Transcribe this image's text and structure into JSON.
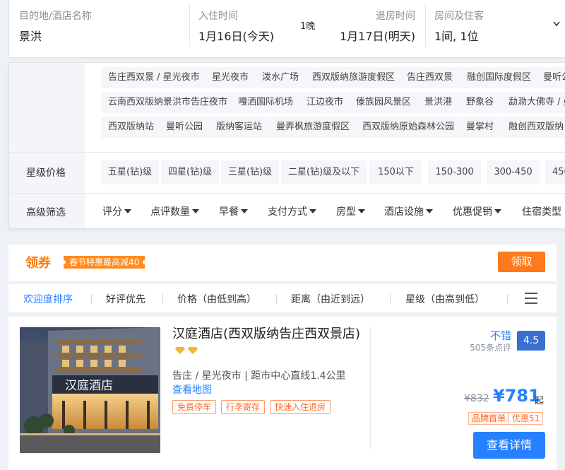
{
  "search": {
    "destination_label": "目的地/酒店名称",
    "destination_value": "景洪",
    "checkin_label": "入住时间",
    "checkin_value": "1月16日(今天)",
    "nights": "1晚",
    "checkout_label": "退房时间",
    "checkout_value": "1月17日(明天)",
    "guests_label": "房间及住客",
    "guests_value": "1间, 1位"
  },
  "location_chips": [
    [
      "告庄西双景 / 星光夜市",
      "星光夜市",
      "泼水广场",
      "西双版纳旅游度假区",
      "告庄西双景",
      "融创国际度假区",
      "曼听公"
    ],
    [
      "云南西双版纳景洪市告庄夜市",
      "嘎洒国际机场",
      "江边夜市",
      "傣族园风景区",
      "景洪港",
      "野象谷",
      "勐泐大佛寺 / 曼"
    ],
    [
      "西双版纳站",
      "曼听公园",
      "版纳客运站",
      "曼弄枫旅游度假区",
      "西双版纳原始森林公园",
      "曼掌村",
      "融创西双版纳"
    ]
  ],
  "star_price": {
    "label": "星级价格",
    "options": [
      "五星(钻)级",
      "四星(钻)级",
      "三星(钻)级",
      "二星(钻)级及以下",
      "150以下",
      "150-300",
      "300-450",
      "450"
    ]
  },
  "advanced": {
    "label": "高级筛选",
    "options": [
      "评分",
      "点评数量",
      "早餐",
      "支付方式",
      "房型",
      "酒店设施",
      "优惠促销",
      "住宿类型"
    ]
  },
  "coupon": {
    "title": "领券",
    "tag": "春节特惠最高减40",
    "button": "领取"
  },
  "sort": {
    "items": [
      "欢迎度排序",
      "好评优先",
      "价格（由低到高）",
      "距离（由近到远）",
      "星级（由高到低）"
    ]
  },
  "hotel": {
    "name": "汉庭酒店(西双版纳告庄西双景店)",
    "location": "告庄 / 星光夜市 | 距市中心直线1.4公里",
    "map_link": "查看地图",
    "tags": [
      "免费停车",
      "行李寄存",
      "快速入住退房"
    ],
    "rating_word": "不错",
    "review_count": "505条点评",
    "score": "4.5",
    "price_old": "¥832",
    "price_now": "¥781",
    "price_unit": "起",
    "promo_1": "品牌首单",
    "promo_2": "优惠51",
    "detail_button": "查看详情",
    "sign_text": "汉庭酒店"
  },
  "colors": {
    "accent_blue": "#2681ff",
    "accent_orange": "#ff7a1c",
    "score_blue": "#3a6fd0"
  }
}
